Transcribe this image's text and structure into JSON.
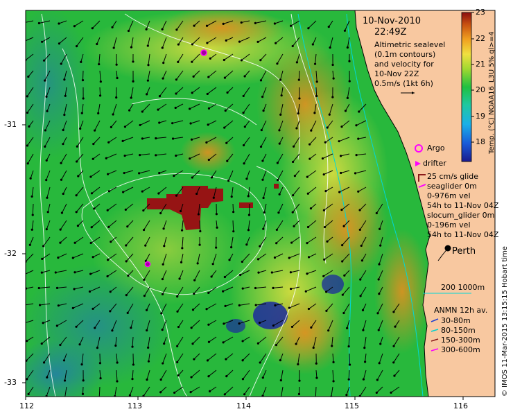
{
  "header": {
    "date": "10-Nov-2010",
    "time": "22:49Z",
    "description_lines": [
      "Altimetric sealevel",
      "(0.1m contours)",
      "and velocity for",
      "10-Nov 22Z",
      "0.5m/s (1kt 6h)"
    ]
  },
  "axes": {
    "x_ticks": [
      "112",
      "113",
      "114",
      "115",
      "116"
    ],
    "y_ticks": [
      "-31",
      "-32",
      "-33"
    ]
  },
  "colorbar": {
    "title": "Temp. (°C) NOAA16_L3U 5% ql>=4",
    "ticks": [
      "23",
      "22",
      "21",
      "20",
      "19",
      "18"
    ],
    "range": [
      17.3,
      23
    ]
  },
  "legend": {
    "argo": "Argo",
    "drifter": "drifter",
    "glide": "25 cm/s glide",
    "seaglider": "seaglider 0m",
    "seaglider_vel": "0-976m vel",
    "seaglider_time": "54h to 11-Nov 04Z",
    "slocum": "slocum_glider 0m",
    "slocum_vel": "0-196m vel",
    "slocum_time": "54h to 11-Nov 04Z",
    "depth_contours": "200  1000m",
    "anmn_title": "ANMN 12h av.",
    "anmn_items": [
      {
        "label": "30-80m",
        "color": "#1f3fd0"
      },
      {
        "label": "80-150m",
        "color": "#00d0d0"
      },
      {
        "label": "150-300m",
        "color": "#8b1a1a"
      },
      {
        "label": "300-600m",
        "color": "#ff00ff"
      }
    ]
  },
  "city": {
    "name": "Perth"
  },
  "footer": {
    "credit": "© IMOS 11-Mar-2015 13:15:15 Hobart time"
  },
  "colors": {
    "land": "#f8c8a0",
    "argo": "#ff00ff",
    "slocum": "#ff00ff",
    "glide": "#8b1a1a"
  }
}
